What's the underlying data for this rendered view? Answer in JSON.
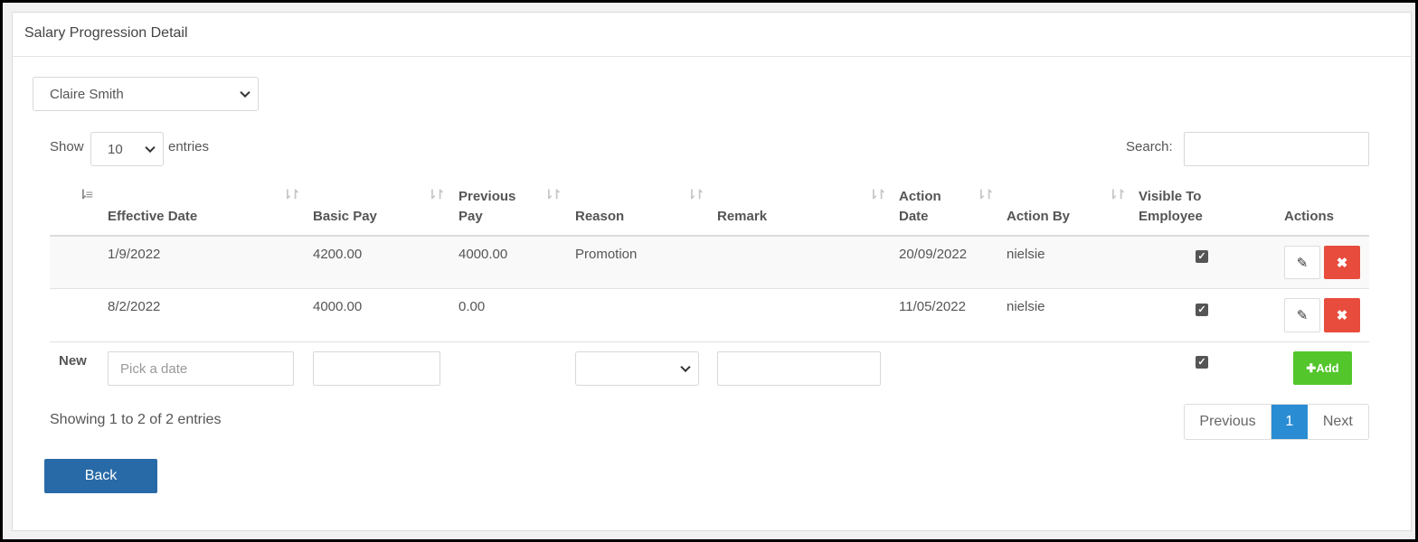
{
  "panel": {
    "title": "Salary Progression Detail"
  },
  "employee_select": {
    "value": "Claire Smith"
  },
  "length": {
    "show_label": "Show",
    "value": "10",
    "entries_label": "entries"
  },
  "search": {
    "label": "Search:",
    "value": ""
  },
  "table": {
    "columns": [
      "Effective Date",
      "Basic Pay",
      "Previous Pay",
      "Reason",
      "Remark",
      "Action Date",
      "Action By",
      "Visible To Employee",
      "Actions"
    ],
    "col_lines": {
      "prev_1": "Previous",
      "prev_2": "Pay",
      "action_1": "Action",
      "action_2": "Date",
      "visible_1": "Visible To",
      "visible_2": "Employee"
    },
    "rows": [
      {
        "effective_date": "1/9/2022",
        "basic_pay": "4200.00",
        "previous_pay": "4000.00",
        "reason": "Promotion",
        "remark": "",
        "action_date": "20/09/2022",
        "action_by": "nielsie",
        "visible": true
      },
      {
        "effective_date": "8/2/2022",
        "basic_pay": "4000.00",
        "previous_pay": "0.00",
        "reason": "",
        "remark": "",
        "action_date": "11/05/2022",
        "action_by": "nielsie",
        "visible": true
      }
    ],
    "new_row": {
      "label": "New",
      "date_placeholder": "Pick a date",
      "visible": true,
      "add_label": "Add"
    }
  },
  "info": "Showing 1 to 2 of 2 entries",
  "pagination": {
    "previous": "Previous",
    "current": "1",
    "next": "Next"
  },
  "back_label": "Back",
  "colors": {
    "delete": "#e74c3c",
    "add": "#52c62b",
    "back": "#286aa7",
    "page_active": "#2a8dd4"
  }
}
